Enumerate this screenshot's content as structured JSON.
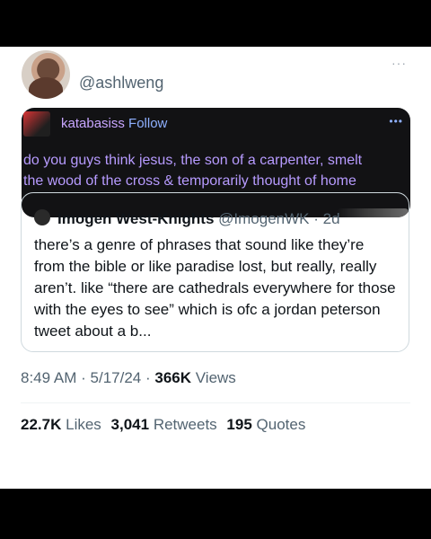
{
  "author": {
    "handle": "@ashlweng"
  },
  "more_label": "···",
  "media": {
    "username": "katabasiss",
    "follow": "Follow",
    "dots": "•••",
    "text_line1": "do you guys think jesus, the son of a carpenter, smelt",
    "text_line2": "the wood of the cross & temporarily thought of home"
  },
  "quote": {
    "name": "Imogen West-Knights",
    "handle": "@ImogenWK",
    "separator": "·",
    "age": "2d",
    "body": "there’s a genre of phrases that sound like they’re from the bible or like paradise lost, but really, really aren’t. like “there are cathedrals everywhere for those with the eyes to see” which is ofc a jordan peterson tweet about a b..."
  },
  "timeline": {
    "time": "8:49 AM",
    "separator": "·",
    "date": "5/17/24",
    "views_count": "366K",
    "views_label": "Views"
  },
  "stats": {
    "likes_count": "22.7K",
    "likes_label": "Likes",
    "retweets_count": "3,041",
    "retweets_label": "Retweets",
    "quotes_count": "195",
    "quotes_label": "Quotes"
  }
}
